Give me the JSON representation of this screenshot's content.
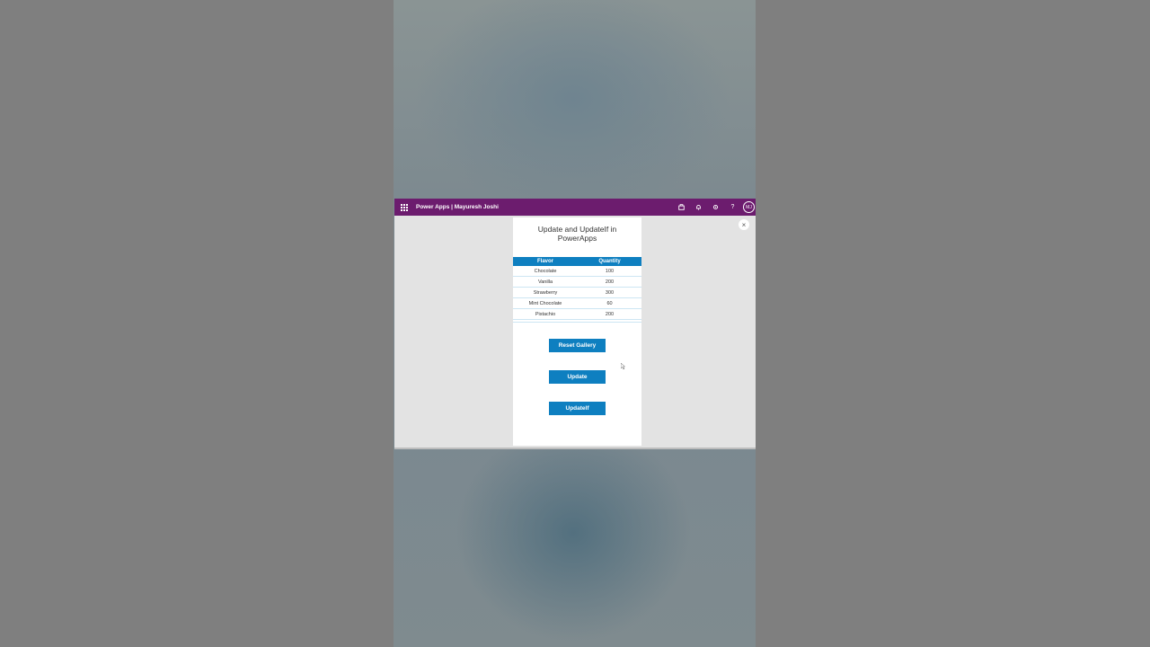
{
  "topbar": {
    "title": "Power Apps  |  Mayuresh Joshi",
    "avatar": "MJ"
  },
  "app": {
    "title_line1": "Update and UpdateIf in",
    "title_line2": "PowerApps"
  },
  "gallery": {
    "headers": [
      "Flavor",
      "Quantity"
    ],
    "rows": [
      {
        "flavor": "Chocolate",
        "quantity": "100"
      },
      {
        "flavor": "Vanilla",
        "quantity": "200"
      },
      {
        "flavor": "Strawberry",
        "quantity": "300"
      },
      {
        "flavor": "Mint Chocolate",
        "quantity": "60"
      },
      {
        "flavor": "Pistachio",
        "quantity": "200"
      }
    ]
  },
  "buttons": {
    "reset": "Reset Gallery",
    "update": "Update",
    "updateif": "UpdateIf"
  },
  "icons": {
    "close": "×",
    "help": "?"
  },
  "colors": {
    "topbar": "#6c1c6e",
    "accent": "#0e7fc0"
  }
}
